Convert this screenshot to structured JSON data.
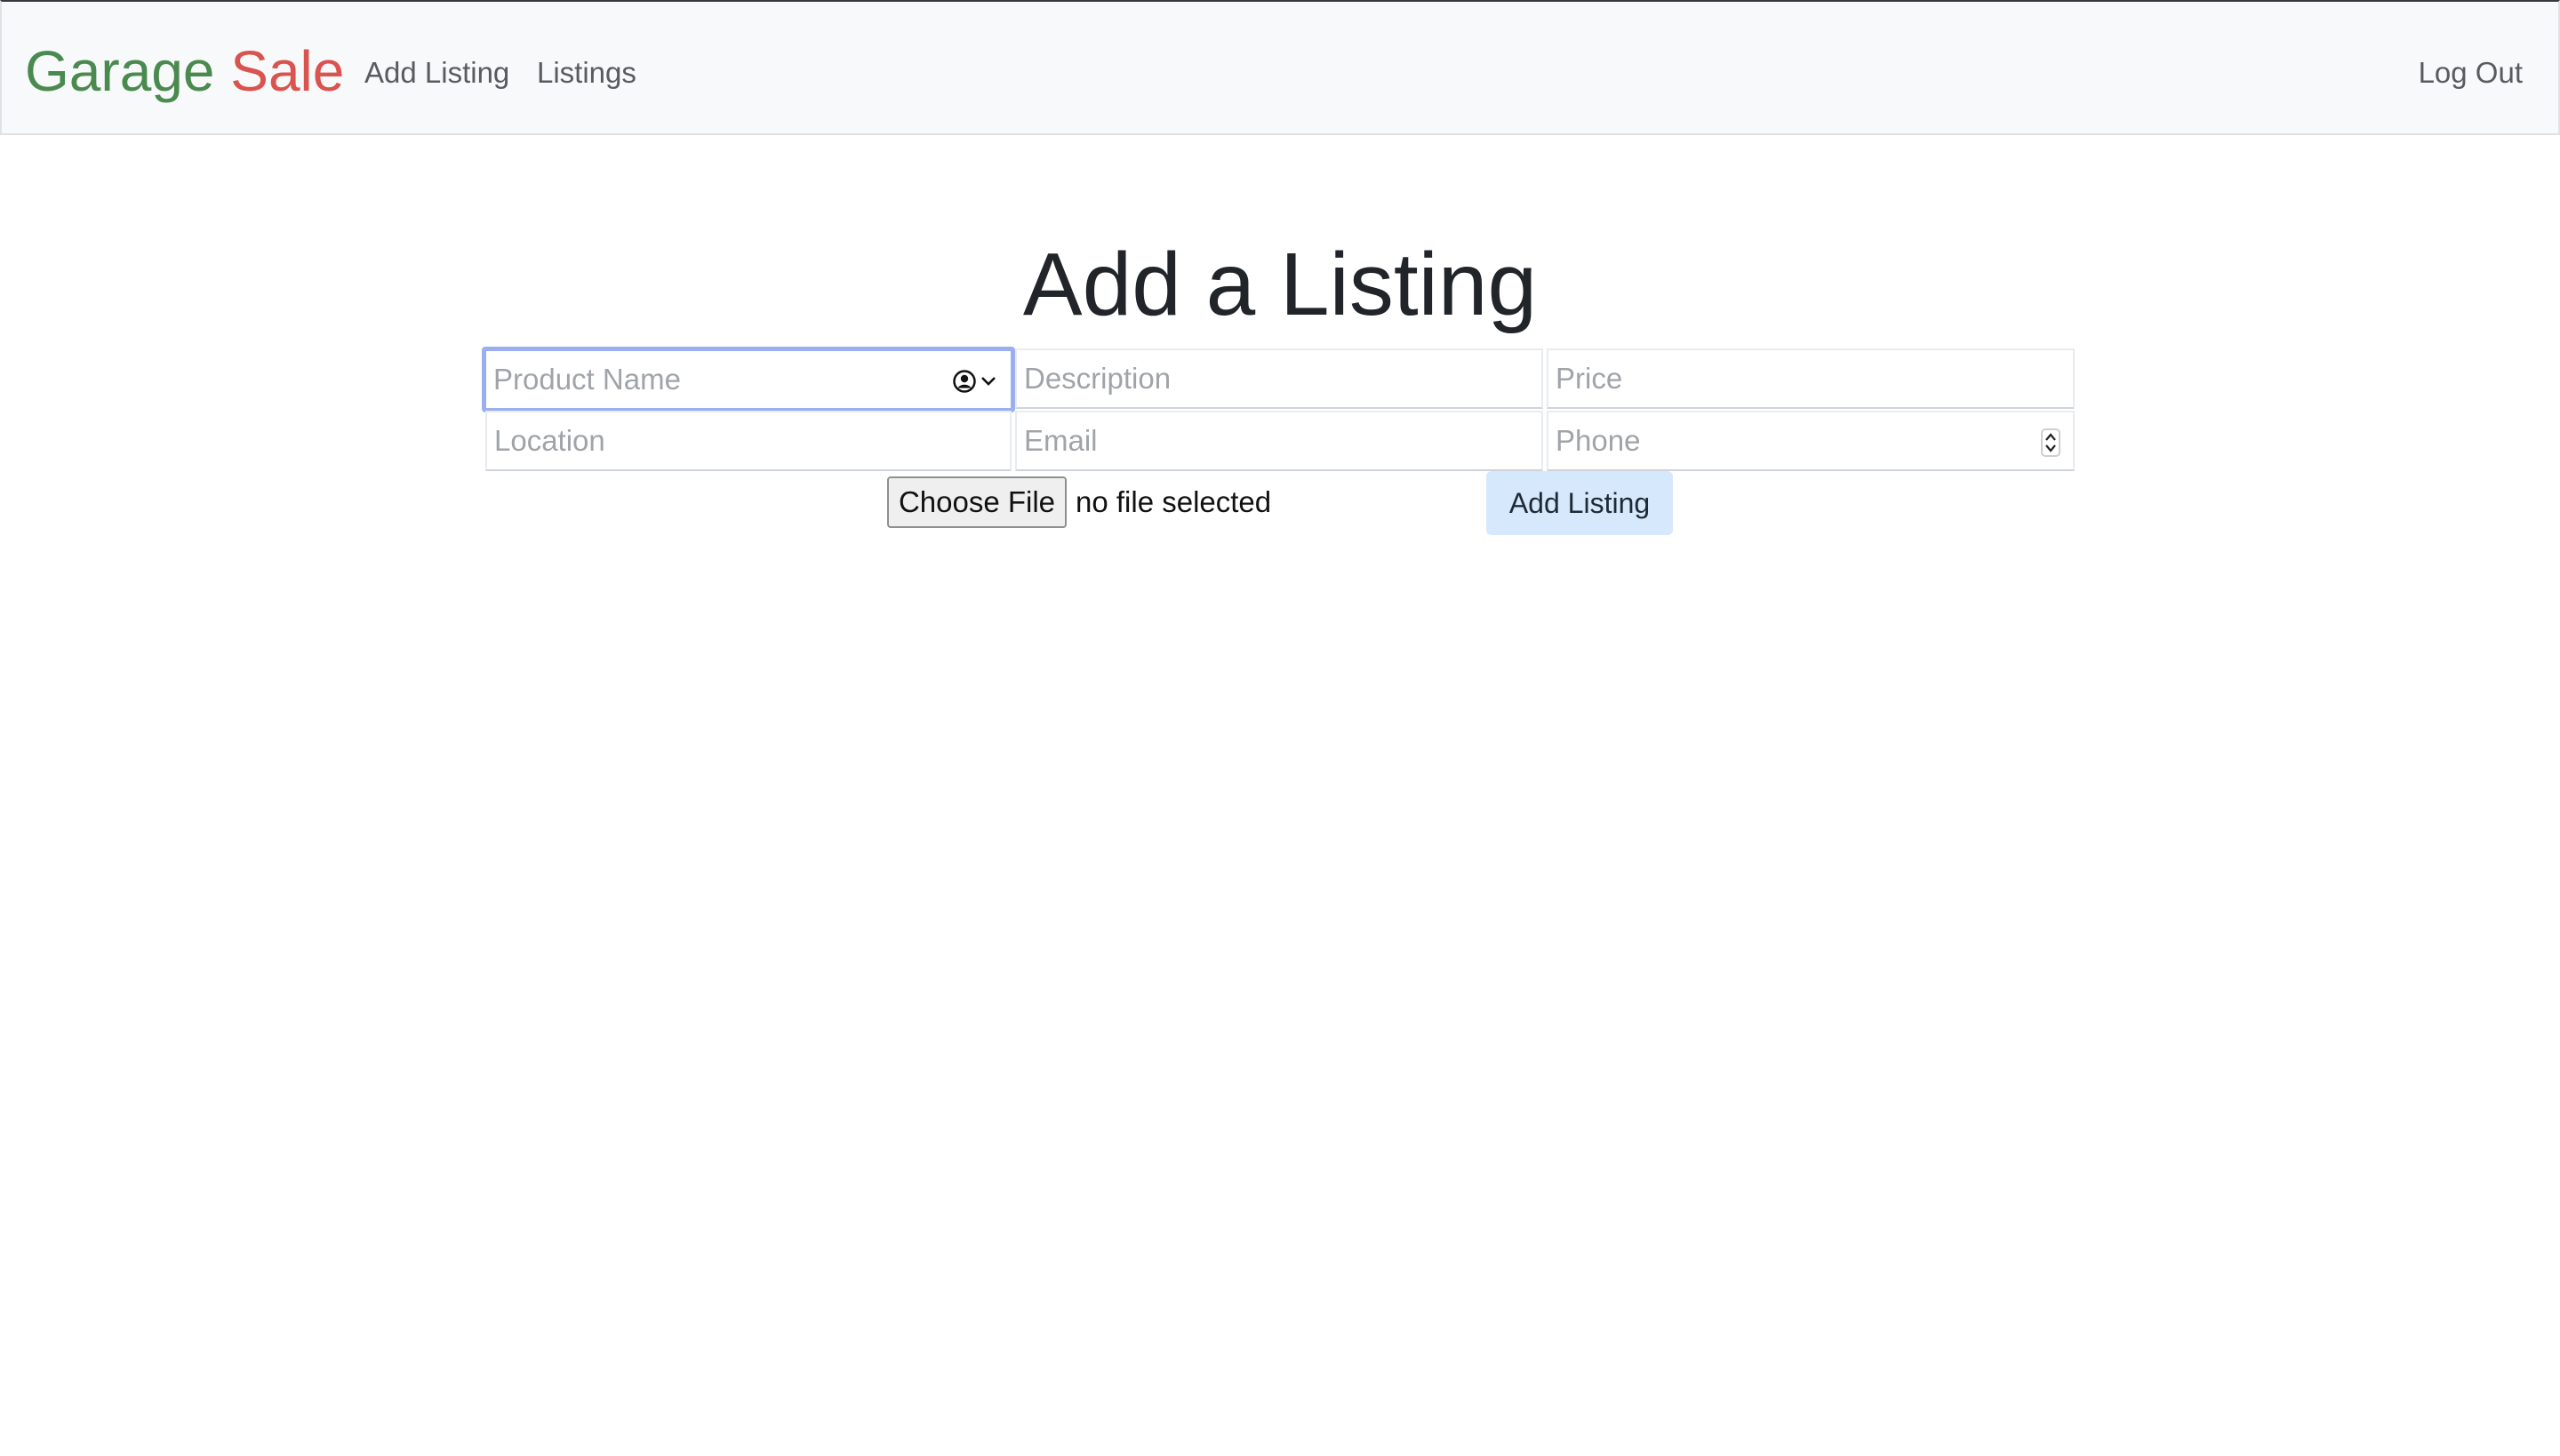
{
  "navbar": {
    "brand_part1": "Garage",
    "brand_part2": "Sale",
    "links": [
      {
        "label": "Add Listing"
      },
      {
        "label": "Listings"
      }
    ],
    "logout_label": "Log Out"
  },
  "main": {
    "title": "Add a Listing",
    "fields": {
      "product_name": {
        "placeholder": "Product Name",
        "value": ""
      },
      "description": {
        "placeholder": "Description",
        "value": ""
      },
      "price": {
        "placeholder": "Price",
        "value": ""
      },
      "location": {
        "placeholder": "Location",
        "value": ""
      },
      "email": {
        "placeholder": "Email",
        "value": ""
      },
      "phone": {
        "placeholder": "Phone",
        "value": ""
      }
    },
    "file_button_label": "Choose File",
    "file_status": "no file selected",
    "submit_label": "Add Listing"
  },
  "icons": {
    "autofill": "contact-autofill-icon",
    "spinner": "number-spinner-icon"
  },
  "colors": {
    "brand_green": "#4a8a4f",
    "brand_red": "#d9534f",
    "focus_border": "#9aaef0",
    "submit_bg": "#d6e8fb",
    "navbar_bg": "#f8f9fa"
  }
}
